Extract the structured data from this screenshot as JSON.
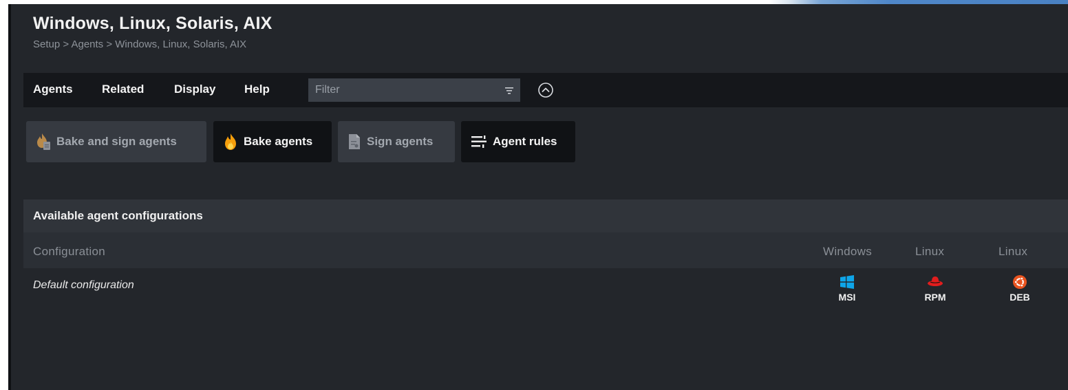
{
  "header": {
    "title": "Windows, Linux, Solaris, AIX",
    "breadcrumb": "Setup > Agents > Windows, Linux, Solaris, AIX"
  },
  "menu": {
    "items": [
      "Agents",
      "Related",
      "Display",
      "Help"
    ],
    "filter_placeholder": "Filter",
    "filter_icon": "filter-icon",
    "collapse_icon": "chevron-up-circle-icon"
  },
  "toolbar": {
    "buttons": [
      {
        "label": "Bake and sign agents",
        "icon": "flame-document-icon",
        "state": "disabled"
      },
      {
        "label": "Bake agents",
        "icon": "flame-icon",
        "state": "enabled"
      },
      {
        "label": "Sign agents",
        "icon": "certificate-document-icon",
        "state": "disabled"
      },
      {
        "label": "Agent rules",
        "icon": "rules-list-icon",
        "state": "enabled"
      }
    ]
  },
  "panel": {
    "title": "Available agent configurations",
    "columns": [
      "Configuration",
      "Windows",
      "Linux",
      "Linux"
    ],
    "rows": [
      {
        "configuration": "Default configuration",
        "packages": [
          {
            "label": "MSI",
            "icon": "windows-logo-icon",
            "color": "#0ea5e9"
          },
          {
            "label": "RPM",
            "icon": "redhat-logo-icon",
            "color": "#e11d1d"
          },
          {
            "label": "DEB",
            "icon": "ubuntu-logo-icon",
            "color": "#e95420"
          }
        ]
      }
    ]
  },
  "colors": {
    "app_background": "#23262b",
    "menubar_background": "#15171b",
    "flame_orange": "#f59e0b"
  }
}
